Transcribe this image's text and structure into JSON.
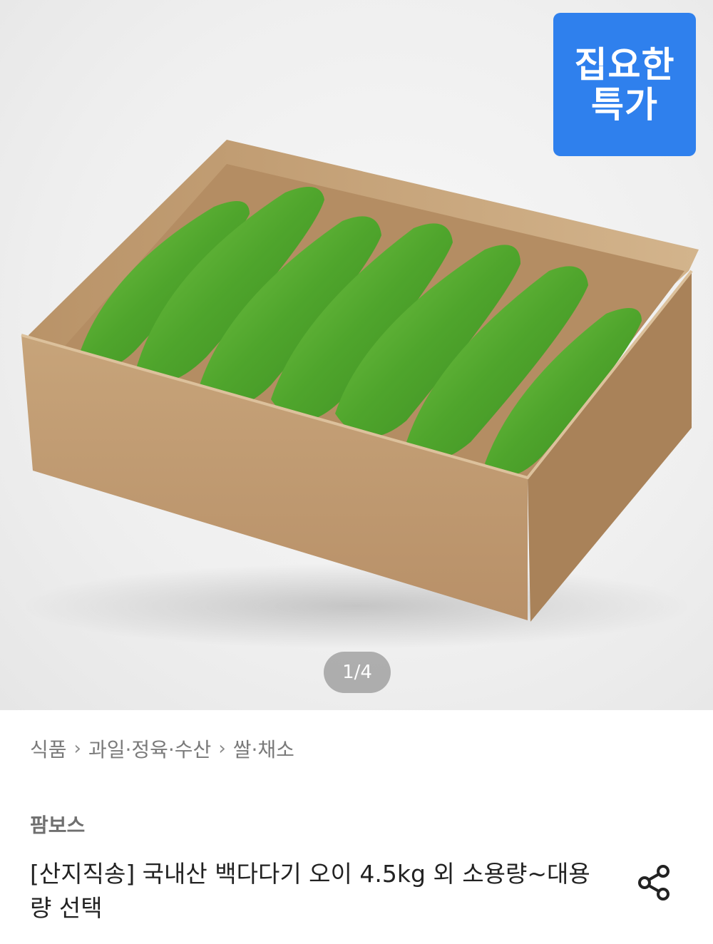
{
  "hero": {
    "badge_line1": "집요한",
    "badge_line2": "특가",
    "counter": "1/4"
  },
  "breadcrumb": [
    "식품",
    "과일·정육·수산",
    "쌀·채소"
  ],
  "seller": "팜보스",
  "product": {
    "title": "[산지직송] 국내산 백다다기 오이 4.5kg 외 소용량~대용량 선택"
  },
  "icons": {
    "share": "share-icon",
    "chevron": "chevron-right-icon"
  },
  "colors": {
    "badge": "#2f80ed",
    "cucumber": "#5fb33a",
    "box": "#c9a77b"
  }
}
